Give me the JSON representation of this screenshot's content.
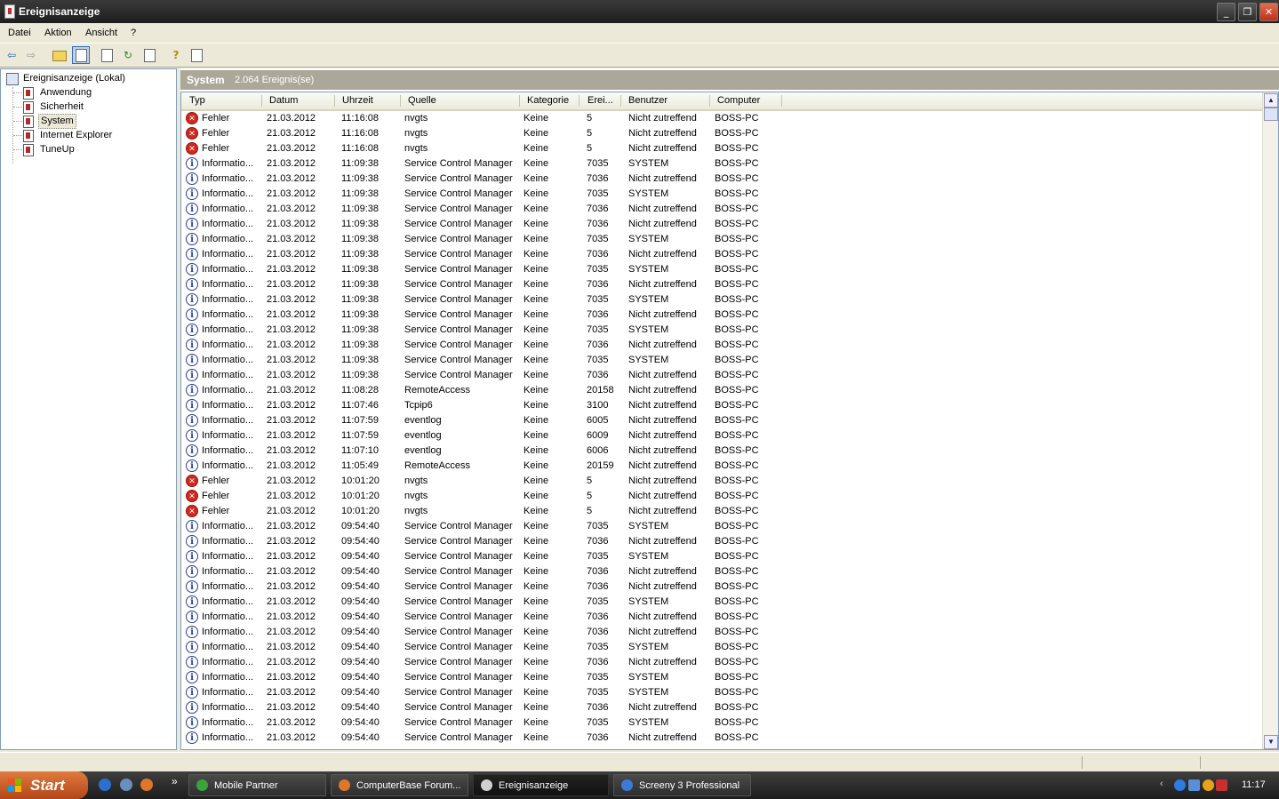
{
  "window": {
    "title": "Ereignisanzeige",
    "btn_min": "_",
    "btn_max": "❐",
    "btn_close": "✕"
  },
  "menu": [
    "Datei",
    "Aktion",
    "Ansicht",
    "?"
  ],
  "toolbar": {
    "back_icon": "arrow-left-icon",
    "forward_icon": "arrow-right-icon"
  },
  "tree": {
    "root": "Ereignisanzeige (Lokal)",
    "items": [
      {
        "label": "Anwendung"
      },
      {
        "label": "Sicherheit"
      },
      {
        "label": "System",
        "selected": true
      },
      {
        "label": "Internet Explorer"
      },
      {
        "label": "TuneUp"
      }
    ]
  },
  "pane": {
    "name": "System",
    "count": "2.064 Ereignis(se)"
  },
  "columns": [
    "Typ",
    "Datum",
    "Uhrzeit",
    "Quelle",
    "Kategorie",
    "Erei...",
    "Benutzer",
    "Computer"
  ],
  "events": [
    [
      "Fehler",
      "21.03.2012",
      "11:16:08",
      "nvgts",
      "Keine",
      "5",
      "Nicht zutreffend",
      "BOSS-PC"
    ],
    [
      "Fehler",
      "21.03.2012",
      "11:16:08",
      "nvgts",
      "Keine",
      "5",
      "Nicht zutreffend",
      "BOSS-PC"
    ],
    [
      "Fehler",
      "21.03.2012",
      "11:16:08",
      "nvgts",
      "Keine",
      "5",
      "Nicht zutreffend",
      "BOSS-PC"
    ],
    [
      "Informatio...",
      "21.03.2012",
      "11:09:38",
      "Service Control Manager",
      "Keine",
      "7035",
      "SYSTEM",
      "BOSS-PC"
    ],
    [
      "Informatio...",
      "21.03.2012",
      "11:09:38",
      "Service Control Manager",
      "Keine",
      "7036",
      "Nicht zutreffend",
      "BOSS-PC"
    ],
    [
      "Informatio...",
      "21.03.2012",
      "11:09:38",
      "Service Control Manager",
      "Keine",
      "7035",
      "SYSTEM",
      "BOSS-PC"
    ],
    [
      "Informatio...",
      "21.03.2012",
      "11:09:38",
      "Service Control Manager",
      "Keine",
      "7036",
      "Nicht zutreffend",
      "BOSS-PC"
    ],
    [
      "Informatio...",
      "21.03.2012",
      "11:09:38",
      "Service Control Manager",
      "Keine",
      "7036",
      "Nicht zutreffend",
      "BOSS-PC"
    ],
    [
      "Informatio...",
      "21.03.2012",
      "11:09:38",
      "Service Control Manager",
      "Keine",
      "7035",
      "SYSTEM",
      "BOSS-PC"
    ],
    [
      "Informatio...",
      "21.03.2012",
      "11:09:38",
      "Service Control Manager",
      "Keine",
      "7036",
      "Nicht zutreffend",
      "BOSS-PC"
    ],
    [
      "Informatio...",
      "21.03.2012",
      "11:09:38",
      "Service Control Manager",
      "Keine",
      "7035",
      "SYSTEM",
      "BOSS-PC"
    ],
    [
      "Informatio...",
      "21.03.2012",
      "11:09:38",
      "Service Control Manager",
      "Keine",
      "7036",
      "Nicht zutreffend",
      "BOSS-PC"
    ],
    [
      "Informatio...",
      "21.03.2012",
      "11:09:38",
      "Service Control Manager",
      "Keine",
      "7035",
      "SYSTEM",
      "BOSS-PC"
    ],
    [
      "Informatio...",
      "21.03.2012",
      "11:09:38",
      "Service Control Manager",
      "Keine",
      "7036",
      "Nicht zutreffend",
      "BOSS-PC"
    ],
    [
      "Informatio...",
      "21.03.2012",
      "11:09:38",
      "Service Control Manager",
      "Keine",
      "7035",
      "SYSTEM",
      "BOSS-PC"
    ],
    [
      "Informatio...",
      "21.03.2012",
      "11:09:38",
      "Service Control Manager",
      "Keine",
      "7036",
      "Nicht zutreffend",
      "BOSS-PC"
    ],
    [
      "Informatio...",
      "21.03.2012",
      "11:09:38",
      "Service Control Manager",
      "Keine",
      "7035",
      "SYSTEM",
      "BOSS-PC"
    ],
    [
      "Informatio...",
      "21.03.2012",
      "11:09:38",
      "Service Control Manager",
      "Keine",
      "7036",
      "Nicht zutreffend",
      "BOSS-PC"
    ],
    [
      "Informatio...",
      "21.03.2012",
      "11:08:28",
      "RemoteAccess",
      "Keine",
      "20158",
      "Nicht zutreffend",
      "BOSS-PC"
    ],
    [
      "Informatio...",
      "21.03.2012",
      "11:07:46",
      "Tcpip6",
      "Keine",
      "3100",
      "Nicht zutreffend",
      "BOSS-PC"
    ],
    [
      "Informatio...",
      "21.03.2012",
      "11:07:59",
      "eventlog",
      "Keine",
      "6005",
      "Nicht zutreffend",
      "BOSS-PC"
    ],
    [
      "Informatio...",
      "21.03.2012",
      "11:07:59",
      "eventlog",
      "Keine",
      "6009",
      "Nicht zutreffend",
      "BOSS-PC"
    ],
    [
      "Informatio...",
      "21.03.2012",
      "11:07:10",
      "eventlog",
      "Keine",
      "6006",
      "Nicht zutreffend",
      "BOSS-PC"
    ],
    [
      "Informatio...",
      "21.03.2012",
      "11:05:49",
      "RemoteAccess",
      "Keine",
      "20159",
      "Nicht zutreffend",
      "BOSS-PC"
    ],
    [
      "Fehler",
      "21.03.2012",
      "10:01:20",
      "nvgts",
      "Keine",
      "5",
      "Nicht zutreffend",
      "BOSS-PC"
    ],
    [
      "Fehler",
      "21.03.2012",
      "10:01:20",
      "nvgts",
      "Keine",
      "5",
      "Nicht zutreffend",
      "BOSS-PC"
    ],
    [
      "Fehler",
      "21.03.2012",
      "10:01:20",
      "nvgts",
      "Keine",
      "5",
      "Nicht zutreffend",
      "BOSS-PC"
    ],
    [
      "Informatio...",
      "21.03.2012",
      "09:54:40",
      "Service Control Manager",
      "Keine",
      "7035",
      "SYSTEM",
      "BOSS-PC"
    ],
    [
      "Informatio...",
      "21.03.2012",
      "09:54:40",
      "Service Control Manager",
      "Keine",
      "7036",
      "Nicht zutreffend",
      "BOSS-PC"
    ],
    [
      "Informatio...",
      "21.03.2012",
      "09:54:40",
      "Service Control Manager",
      "Keine",
      "7035",
      "SYSTEM",
      "BOSS-PC"
    ],
    [
      "Informatio...",
      "21.03.2012",
      "09:54:40",
      "Service Control Manager",
      "Keine",
      "7036",
      "Nicht zutreffend",
      "BOSS-PC"
    ],
    [
      "Informatio...",
      "21.03.2012",
      "09:54:40",
      "Service Control Manager",
      "Keine",
      "7036",
      "Nicht zutreffend",
      "BOSS-PC"
    ],
    [
      "Informatio...",
      "21.03.2012",
      "09:54:40",
      "Service Control Manager",
      "Keine",
      "7035",
      "SYSTEM",
      "BOSS-PC"
    ],
    [
      "Informatio...",
      "21.03.2012",
      "09:54:40",
      "Service Control Manager",
      "Keine",
      "7036",
      "Nicht zutreffend",
      "BOSS-PC"
    ],
    [
      "Informatio...",
      "21.03.2012",
      "09:54:40",
      "Service Control Manager",
      "Keine",
      "7036",
      "Nicht zutreffend",
      "BOSS-PC"
    ],
    [
      "Informatio...",
      "21.03.2012",
      "09:54:40",
      "Service Control Manager",
      "Keine",
      "7035",
      "SYSTEM",
      "BOSS-PC"
    ],
    [
      "Informatio...",
      "21.03.2012",
      "09:54:40",
      "Service Control Manager",
      "Keine",
      "7036",
      "Nicht zutreffend",
      "BOSS-PC"
    ],
    [
      "Informatio...",
      "21.03.2012",
      "09:54:40",
      "Service Control Manager",
      "Keine",
      "7035",
      "SYSTEM",
      "BOSS-PC"
    ],
    [
      "Informatio...",
      "21.03.2012",
      "09:54:40",
      "Service Control Manager",
      "Keine",
      "7035",
      "SYSTEM",
      "BOSS-PC"
    ],
    [
      "Informatio...",
      "21.03.2012",
      "09:54:40",
      "Service Control Manager",
      "Keine",
      "7036",
      "Nicht zutreffend",
      "BOSS-PC"
    ],
    [
      "Informatio...",
      "21.03.2012",
      "09:54:40",
      "Service Control Manager",
      "Keine",
      "7035",
      "SYSTEM",
      "BOSS-PC"
    ],
    [
      "Informatio...",
      "21.03.2012",
      "09:54:40",
      "Service Control Manager",
      "Keine",
      "7036",
      "Nicht zutreffend",
      "BOSS-PC"
    ]
  ],
  "taskbar": {
    "start": "Start",
    "chevron": "»",
    "tasks": [
      {
        "label": "Mobile Partner",
        "icon": "mobile-partner-icon",
        "color": "#3aa33a"
      },
      {
        "label": "ComputerBase Forum...",
        "icon": "firefox-icon",
        "color": "#e0762a"
      },
      {
        "label": "Ereignisanzeige",
        "icon": "event-viewer-icon",
        "color": "#d0d0d0",
        "active": true
      },
      {
        "label": "Screeny 3 Professional",
        "icon": "screeny-icon",
        "color": "#3b7bd6"
      }
    ],
    "clock": "11:17"
  },
  "colors": {
    "error": "#d4271d",
    "info": "#1a3fb0",
    "titlebar": "#2b2b2b",
    "chrome": "#ece9d8",
    "pane_header": "#aca899"
  }
}
